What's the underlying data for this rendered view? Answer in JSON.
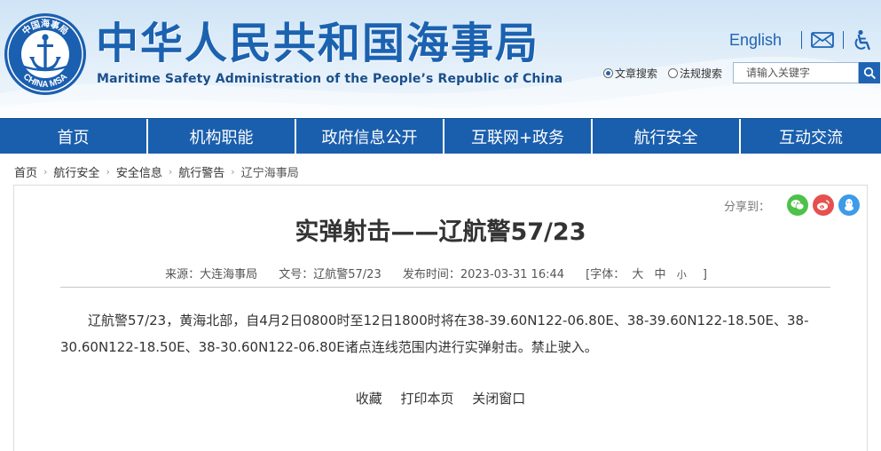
{
  "header": {
    "site_title": "中华人民共和国海事局",
    "site_subtitle": "Maritime Safety Administration of the People’s Republic of China",
    "logo_text_top": "中国海事局",
    "logo_text_bottom": "CHINA MSA",
    "english_link": "English",
    "mail_icon": "mail-icon",
    "accessibility_icon": "accessibility-icon",
    "search": {
      "radio_article": "文章搜索",
      "radio_law": "法规搜索",
      "placeholder": "请输入关键字",
      "search_icon": "search-icon"
    }
  },
  "nav": {
    "items": [
      "首页",
      "机构职能",
      "政府信息公开",
      "互联网+政务",
      "航行安全",
      "互动交流"
    ]
  },
  "breadcrumb": {
    "items": [
      "首页",
      "航行安全",
      "安全信息",
      "航行警告",
      "辽宁海事局"
    ]
  },
  "share": {
    "label": "分享到：",
    "icons": [
      "wechat-icon",
      "weibo-icon",
      "qq-icon"
    ]
  },
  "article": {
    "title": "实弹射击——辽航警57/23",
    "source": "来源：大连海事局",
    "doc_no": "文号：辽航警57/23",
    "published": "发布时间：2023-03-31 16:44",
    "font_size_label": "[字体：",
    "font_size_large": "大",
    "font_size_medium": "中",
    "font_size_small": "小",
    "font_size_end": "]",
    "body": "辽航警57/23，黄海北部，自4月2日0800时至12日1800时将在38-39.60N122-06.80E、38-39.60N122-18.50E、38-30.60N122-18.50E、38-30.60N122-06.80E诸点连线范围内进行实弹射击。禁止驶入。"
  },
  "actions": {
    "favorite": "收藏",
    "print": "打印本页",
    "close": "关闭窗口"
  },
  "colors": {
    "brand_blue": "#1a5fad",
    "title_blue": "#1b62b0",
    "wechat_green": "#4cc24a",
    "weibo_red": "#e6504e",
    "qq_blue": "#3d9be9"
  }
}
